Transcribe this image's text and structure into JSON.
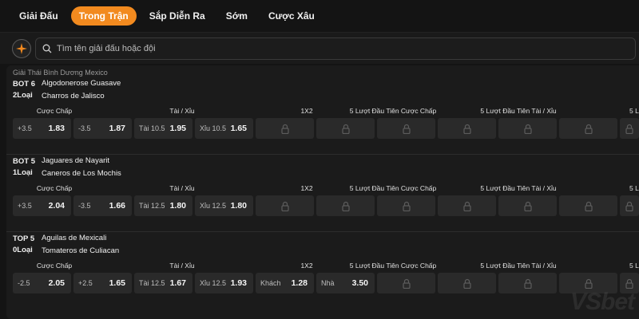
{
  "tabs": [
    {
      "label": "Giải Đấu",
      "active": false
    },
    {
      "label": "Trong Trận",
      "active": true
    },
    {
      "label": "Sắp Diễn Ra",
      "active": false
    },
    {
      "label": "Sớm",
      "active": false
    },
    {
      "label": "Cược Xâu",
      "active": false
    }
  ],
  "search": {
    "placeholder": "Tìm tên giải đấu hoặc đội",
    "value": ""
  },
  "league": {
    "title": "Giải Thái Bình Dương Mexico"
  },
  "market_labels": [
    "Cược Chấp",
    "Tài / Xỉu",
    "1X2",
    "5 Lượt Đầu Tiên Cược Chấp",
    "5 Lượt Đầu Tiên Tài / Xỉu",
    "5 Lư"
  ],
  "matches": [
    {
      "status": "BOT 6",
      "count": "2Loại",
      "home": "Algodonerose Guasave",
      "away": "Charros de Jalisco",
      "odds": [
        {
          "label": "+3.5",
          "value": "1.83"
        },
        {
          "label": "-3.5",
          "value": "1.87"
        },
        {
          "label": "Tài 10.5",
          "value": "1.95"
        },
        {
          "label": "Xỉu 10.5",
          "value": "1.65"
        }
      ],
      "x12": [
        {
          "locked": true
        },
        {
          "locked": true
        }
      ]
    },
    {
      "status": "BOT 5",
      "count": "1Loại",
      "home": "Jaguares de Nayarit",
      "away": "Caneros de Los Mochis",
      "odds": [
        {
          "label": "+3.5",
          "value": "2.04"
        },
        {
          "label": "-3.5",
          "value": "1.66"
        },
        {
          "label": "Tài 12.5",
          "value": "1.80"
        },
        {
          "label": "Xỉu 12.5",
          "value": "1.80"
        }
      ],
      "x12": [
        {
          "locked": true
        },
        {
          "locked": true
        }
      ]
    },
    {
      "status": "TOP 5",
      "count": "0Loại",
      "home": "Aguilas de Mexicali",
      "away": "Tomateros de Culiacan",
      "odds": [
        {
          "label": "-2.5",
          "value": "2.05"
        },
        {
          "label": "+2.5",
          "value": "1.65"
        },
        {
          "label": "Tài 12.5",
          "value": "1.67"
        },
        {
          "label": "Xỉu 12.5",
          "value": "1.93"
        }
      ],
      "x12": [
        {
          "label": "Khách",
          "value": "1.28",
          "locked": false
        },
        {
          "label": "Nhà",
          "value": "3.50",
          "locked": false
        }
      ]
    }
  ],
  "colors": {
    "accent": "#f28a1f",
    "background": "#141414",
    "panel": "#1b1b1b",
    "cell": "#2a2a2a"
  },
  "icons": {
    "spark": "sparkle-icon",
    "search": "search-icon",
    "lock": "lock-icon"
  },
  "watermark": "VSbet"
}
